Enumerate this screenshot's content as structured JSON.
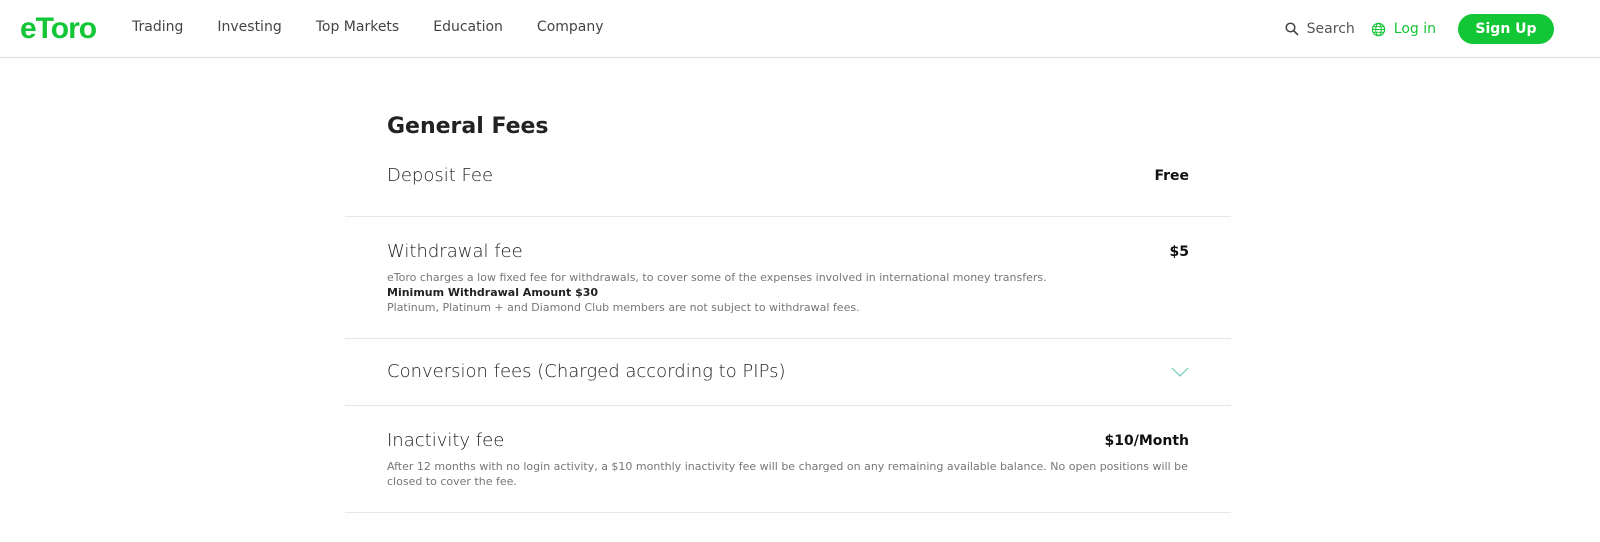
{
  "header": {
    "logo": "eToro",
    "nav": [
      "Trading",
      "Investing",
      "Top Markets",
      "Education",
      "Company"
    ],
    "search": "Search",
    "login": "Log in",
    "signup": "Sign Up",
    "accent": "#13c636"
  },
  "section": {
    "title": "General Fees",
    "rows": [
      {
        "label": "Deposit Fee",
        "value": "Free"
      },
      {
        "label": "Withdrawal fee",
        "value": "$5",
        "desc1": "eToro charges a low fixed fee for withdrawals, to cover some of the expenses involved in international money transfers.",
        "desc2": "Minimum Withdrawal Amount $30",
        "desc3": "Platinum, Platinum + and Diamond Club members are not subject to withdrawal fees."
      },
      {
        "label": "Conversion fees (Charged according to PIPs)",
        "icon": "chevron-down-icon"
      },
      {
        "label": "Inactivity fee",
        "value": "$10/Month",
        "desc1": "After 12 months with no login activity, a $10 monthly inactivity fee will be charged on any remaining available balance. No open positions will be closed to cover the fee."
      }
    ]
  }
}
